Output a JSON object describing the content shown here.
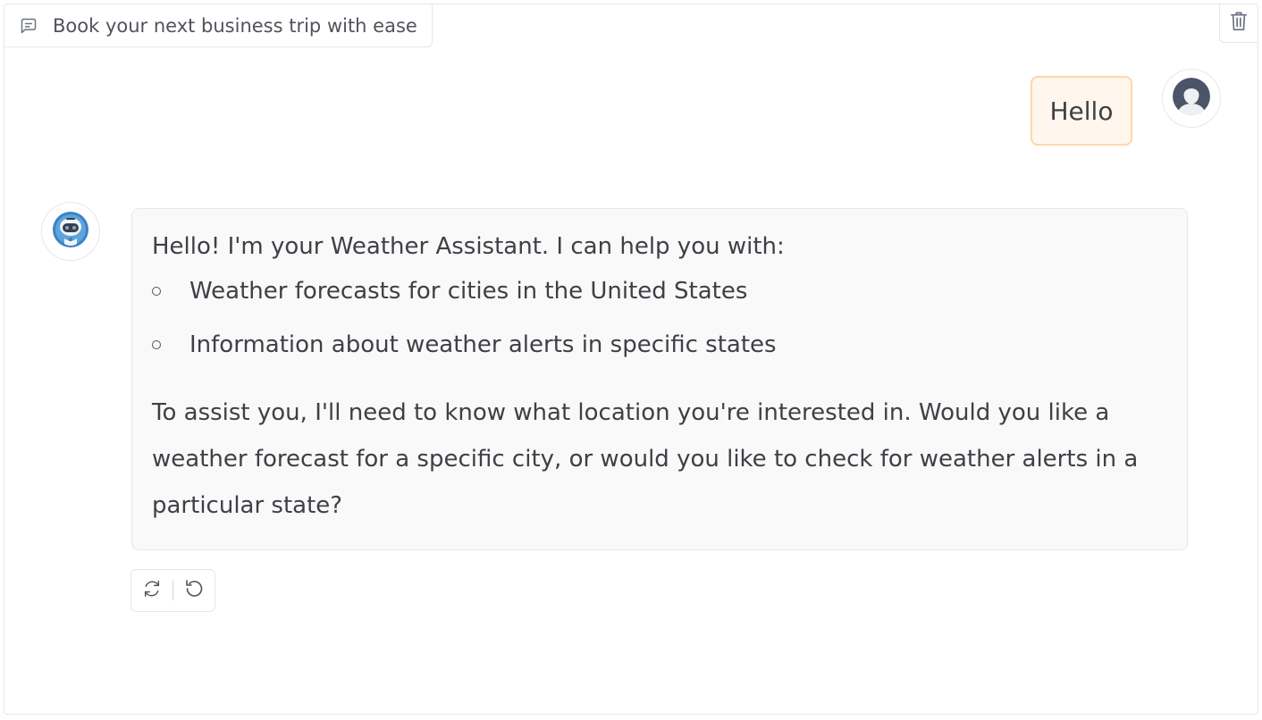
{
  "header": {
    "label": "Book your next business trip with ease",
    "chat_icon": "chat-bubble-icon",
    "clear_icon": "trash-icon"
  },
  "messages": [
    {
      "role": "user",
      "avatar_icon": "user-avatar-icon",
      "text": "Hello"
    },
    {
      "role": "assistant",
      "avatar_icon": "robot-avatar-icon",
      "intro": "Hello! I'm your Weather Assistant. I can help you with:",
      "bullets": [
        "Weather forecasts for cities in the United States",
        "Information about weather alerts in specific states"
      ],
      "outro": "To assist you, I'll need to know what location you're interested in. Would you like a weather forecast for a specific city, or would you like to check for weather alerts in a particular state?"
    }
  ],
  "actions": {
    "retry_icon": "refresh-icon",
    "undo_icon": "undo-icon"
  },
  "colors": {
    "user_bubble_bg": "#fff7ed",
    "user_bubble_border": "#fed7aa",
    "bot_bubble_bg": "#f9f9f9",
    "border": "#e5e7eb",
    "text": "#3f3f46"
  }
}
